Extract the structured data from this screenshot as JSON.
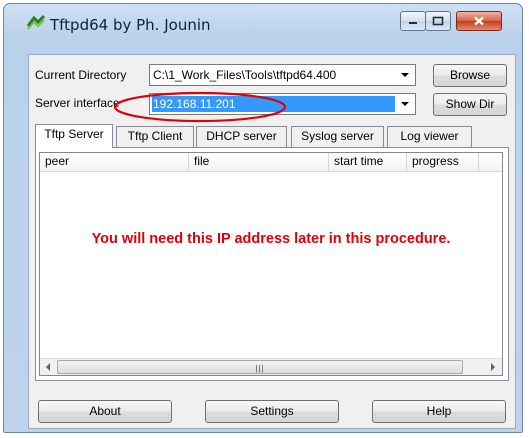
{
  "window": {
    "title": "Tftpd64 by Ph. Jounin",
    "icons": {
      "app": "tftpd-app-icon",
      "minimize": "minimize-icon",
      "maximize": "maximize-icon",
      "close": "close-icon"
    },
    "colors": {
      "close_button": "#c43b1f",
      "selection": "#3399ff",
      "annotation": "#e0000a"
    }
  },
  "form": {
    "current_directory_label": "Current Directory",
    "current_directory_value": "C:\\1_Work_Files\\Tools\\tftpd64.400",
    "browse_label": "Browse",
    "server_interface_label": "Server interface",
    "server_interface_value": "192.168.11.201",
    "show_dir_label": "Show Dir"
  },
  "tabs": [
    {
      "label": "Tftp Server",
      "active": true
    },
    {
      "label": "Tftp Client",
      "active": false
    },
    {
      "label": "DHCP server",
      "active": false
    },
    {
      "label": "Syslog server",
      "active": false
    },
    {
      "label": "Log viewer",
      "active": false
    }
  ],
  "list": {
    "columns": [
      "peer",
      "file",
      "start time",
      "progress"
    ],
    "rows": []
  },
  "annotation_text": "You will need this IP address later in this procedure.",
  "footer": {
    "about_label": "About",
    "settings_label": "Settings",
    "help_label": "Help"
  }
}
